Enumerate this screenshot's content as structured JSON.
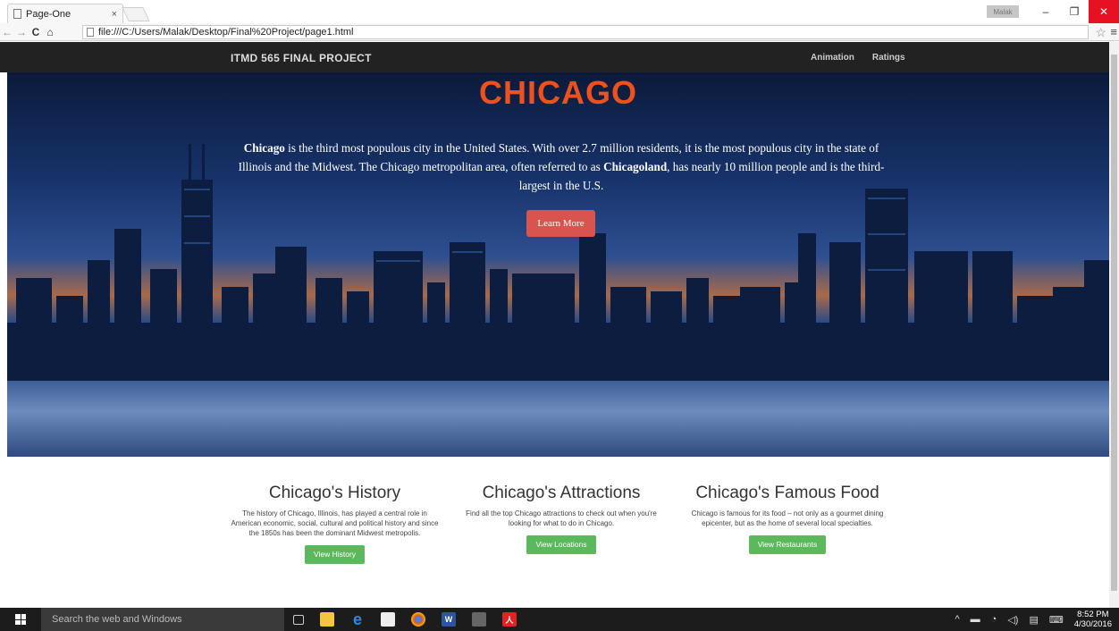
{
  "browser": {
    "tab_title": "Page-One",
    "tab_close": "×",
    "url": "file:///C:/Users/Malak/Desktop/Final%20Project/page1.html",
    "user_chip": "Malak",
    "min": "–",
    "max": "❐",
    "close": "✕",
    "back": "←",
    "forward": "→",
    "reload": "C",
    "home": "⌂",
    "star": "☆",
    "menu": "≡"
  },
  "navbar": {
    "brand": "ITMD 565 FINAL PROJECT",
    "links": [
      "Animation",
      "Ratings"
    ]
  },
  "hero": {
    "title": "CHICAGO",
    "text_bold_1": "Chicago",
    "text_1": " is the third most populous city in the United States. With over 2.7 million residents, it is the most populous city in the state of Illinois and the Midwest. The Chicago metropolitan area, often referred to as ",
    "text_bold_2": "Chicagoland",
    "text_2": ", has nearly 10 million people and is the third-largest in the U.S.",
    "button": "Learn More"
  },
  "columns": [
    {
      "title": "Chicago's History",
      "text": "The history of Chicago, Illinois, has played a central role in American economic, social, cultural and political history and since the 1850s has been the dominant Midwest metropolis.",
      "button": "View History"
    },
    {
      "title": "Chicago's Attractions",
      "text": "Find all the top Chicago attractions to check out when you're looking for what to do in Chicago.",
      "button": "View Locations"
    },
    {
      "title": "Chicago's Famous Food",
      "text": "Chicago is famous for its food – not only as a gourmet dining epicenter, but as the home of several local specialties.",
      "button": "View Restaurants"
    }
  ],
  "taskbar": {
    "search_placeholder": "Search the web and Windows",
    "time": "8:52 PM",
    "date": "4/30/2016"
  }
}
